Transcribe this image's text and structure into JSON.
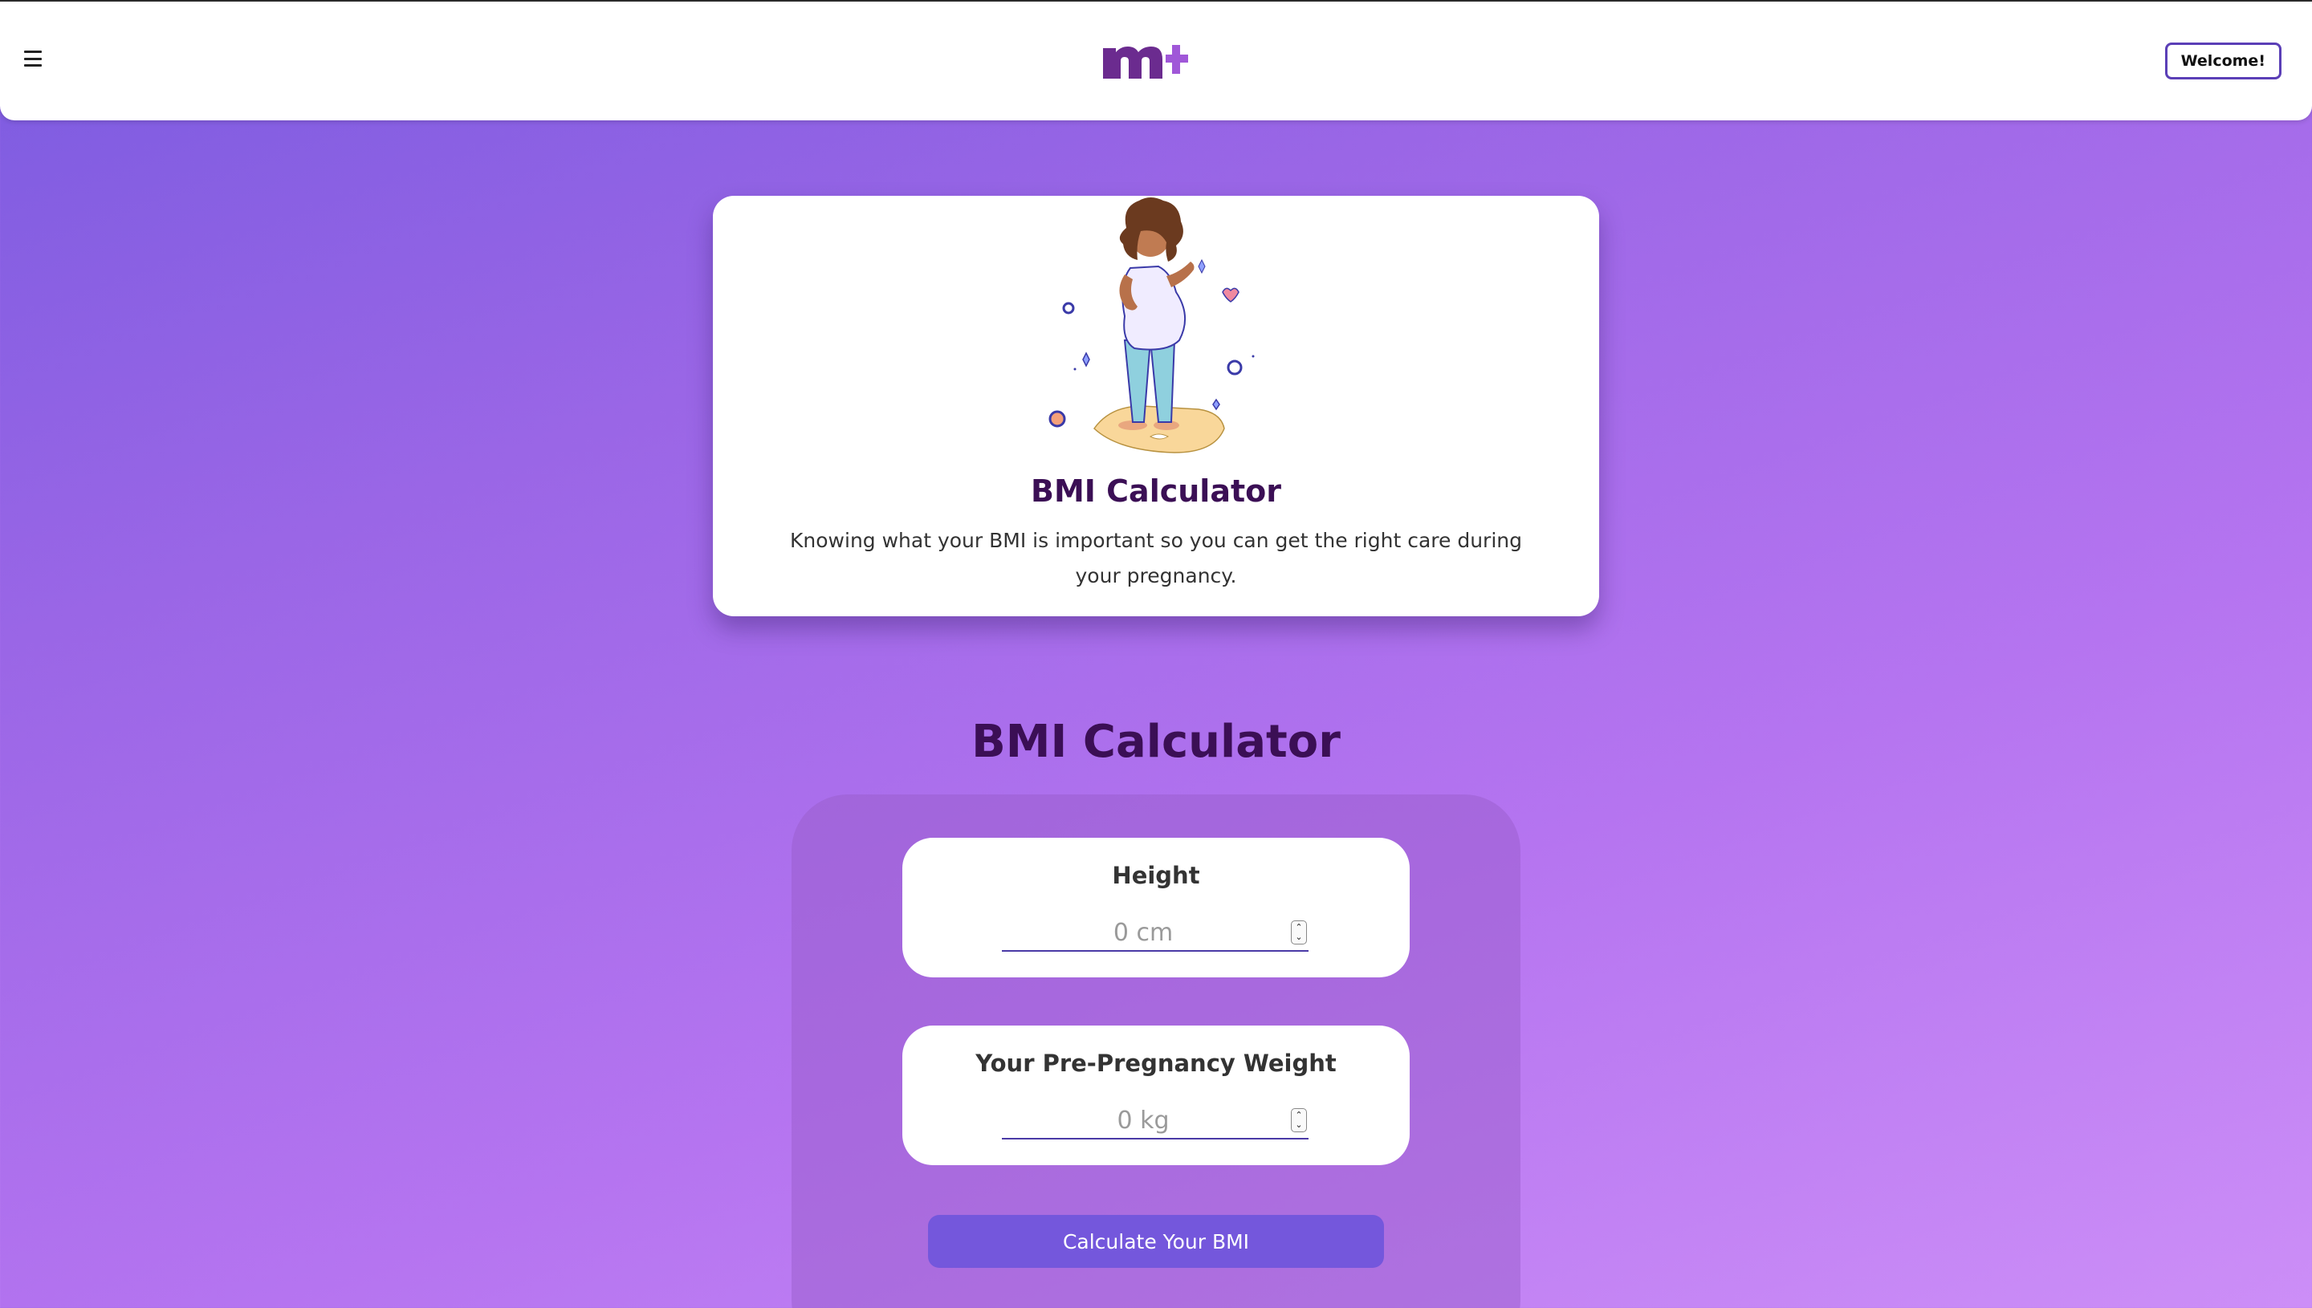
{
  "header": {
    "menu_icon": "hamburger-icon",
    "logo_icon": "m-plus-logo",
    "welcome_label": "Welcome!"
  },
  "hero": {
    "illustration": "pregnant-woman-on-scale-illustration",
    "title": "BMI Calculator",
    "description": "Knowing what your BMI is important so you can get the right care during your pregnancy."
  },
  "calculator": {
    "title": "BMI Calculator",
    "height": {
      "label": "Height",
      "value": "",
      "placeholder": "0 cm"
    },
    "weight": {
      "label": "Your Pre-Pregnancy Weight",
      "value": "",
      "placeholder": "0 kg"
    },
    "submit_label": "Calculate Your BMI"
  },
  "colors": {
    "brand_dark": "#3b0f55",
    "brand_primary": "#7457dc",
    "brand_logo": "#6b2b8f",
    "logo_plus": "#a057d8"
  }
}
